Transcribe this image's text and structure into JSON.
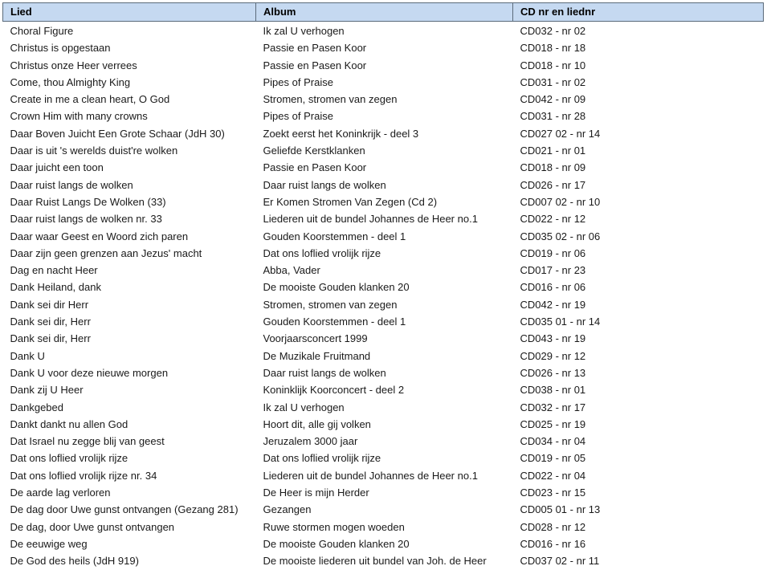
{
  "table": {
    "columns": [
      {
        "key": "lied",
        "label": "Lied"
      },
      {
        "key": "album",
        "label": "Album"
      },
      {
        "key": "cd",
        "label": "CD nr en liednr"
      }
    ],
    "header_background": "#c5d9f1",
    "header_border_color": "#5b6b7b",
    "rows": [
      {
        "lied": "Choral Figure",
        "album": "Ik zal U verhogen",
        "cd": "CD032 - nr 02"
      },
      {
        "lied": "Christus is opgestaan",
        "album": "Passie en Pasen Koor",
        "cd": "CD018 - nr 18"
      },
      {
        "lied": "Christus onze Heer verrees",
        "album": "Passie en Pasen Koor",
        "cd": "CD018 - nr 10"
      },
      {
        "lied": "Come, thou Almighty King",
        "album": "Pipes of Praise",
        "cd": "CD031 - nr 02"
      },
      {
        "lied": "Create in me a clean heart, O God",
        "album": "Stromen, stromen van zegen",
        "cd": "CD042 - nr 09"
      },
      {
        "lied": "Crown Him with many crowns",
        "album": "Pipes of Praise",
        "cd": "CD031 - nr 28"
      },
      {
        "lied": "Daar Boven Juicht Een Grote Schaar (JdH 30)",
        "album": "Zoekt eerst het Koninkrijk - deel 3",
        "cd": "CD027 02 - nr 14"
      },
      {
        "lied": "Daar is uit 's werelds duist're wolken",
        "album": "Geliefde Kerstklanken",
        "cd": "CD021 - nr 01"
      },
      {
        "lied": "Daar juicht een toon",
        "album": "Passie en Pasen Koor",
        "cd": "CD018 - nr 09"
      },
      {
        "lied": "Daar ruist langs de wolken",
        "album": "Daar ruist langs de wolken",
        "cd": "CD026 - nr 17"
      },
      {
        "lied": "Daar Ruist Langs De Wolken (33)",
        "album": "Er Komen Stromen Van Zegen (Cd 2)",
        "cd": "CD007 02 - nr 10"
      },
      {
        "lied": "Daar ruist langs de wolken nr. 33",
        "album": "Liederen uit de bundel Johannes de Heer no.1",
        "cd": "CD022 - nr 12"
      },
      {
        "lied": "Daar waar Geest en Woord zich paren",
        "album": "Gouden Koorstemmen - deel 1",
        "cd": "CD035 02 - nr 06"
      },
      {
        "lied": "Daar zijn geen grenzen aan Jezus' macht",
        "album": "Dat ons loflied vrolijk rijze",
        "cd": "CD019 - nr 06"
      },
      {
        "lied": "Dag en nacht Heer",
        "album": "Abba, Vader",
        "cd": "CD017 - nr 23"
      },
      {
        "lied": "Dank Heiland, dank",
        "album": "De mooiste Gouden klanken 20",
        "cd": "CD016 - nr 06"
      },
      {
        "lied": "Dank sei dir Herr",
        "album": "Stromen, stromen van zegen",
        "cd": "CD042 - nr 19"
      },
      {
        "lied": "Dank sei dir, Herr",
        "album": "Gouden Koorstemmen - deel 1",
        "cd": "CD035 01 - nr 14"
      },
      {
        "lied": "Dank sei dir, Herr",
        "album": "Voorjaarsconcert 1999",
        "cd": "CD043 - nr 19"
      },
      {
        "lied": "Dank U",
        "album": "De Muzikale Fruitmand",
        "cd": "CD029 - nr 12"
      },
      {
        "lied": "Dank U voor deze nieuwe morgen",
        "album": "Daar ruist langs de wolken",
        "cd": "CD026 - nr 13"
      },
      {
        "lied": "Dank zij U Heer",
        "album": "Koninklijk Koorconcert - deel 2",
        "cd": "CD038 - nr 01"
      },
      {
        "lied": "Dankgebed",
        "album": "Ik zal U verhogen",
        "cd": "CD032 - nr 17"
      },
      {
        "lied": "Dankt dankt nu allen God",
        "album": "Hoort dit, alle gij volken",
        "cd": "CD025 - nr 19"
      },
      {
        "lied": "Dat Israel nu zegge blij van geest",
        "album": "Jeruzalem 3000 jaar",
        "cd": "CD034 - nr 04"
      },
      {
        "lied": "Dat ons loflied vrolijk rijze",
        "album": "Dat ons loflied vrolijk rijze",
        "cd": "CD019 - nr 05"
      },
      {
        "lied": "Dat ons loflied vrolijk rijze nr. 34",
        "album": "Liederen uit de bundel Johannes de Heer no.1",
        "cd": "CD022 - nr 04"
      },
      {
        "lied": "De aarde lag verloren",
        "album": "De Heer is mijn Herder",
        "cd": "CD023 - nr 15"
      },
      {
        "lied": "De dag door Uwe gunst ontvangen (Gezang 281)",
        "album": "Gezangen",
        "cd": "CD005 01 - nr 13"
      },
      {
        "lied": "De dag, door Uwe gunst ontvangen",
        "album": "Ruwe stormen mogen woeden",
        "cd": "CD028 - nr 12"
      },
      {
        "lied": "De eeuwige weg",
        "album": "De mooiste Gouden klanken 20",
        "cd": "CD016 - nr 16"
      },
      {
        "lied": "De God des heils (JdH 919)",
        "album": "De mooiste liederen uit bundel van Joh. de Heer",
        "cd": "CD037 02 - nr 11"
      }
    ]
  }
}
